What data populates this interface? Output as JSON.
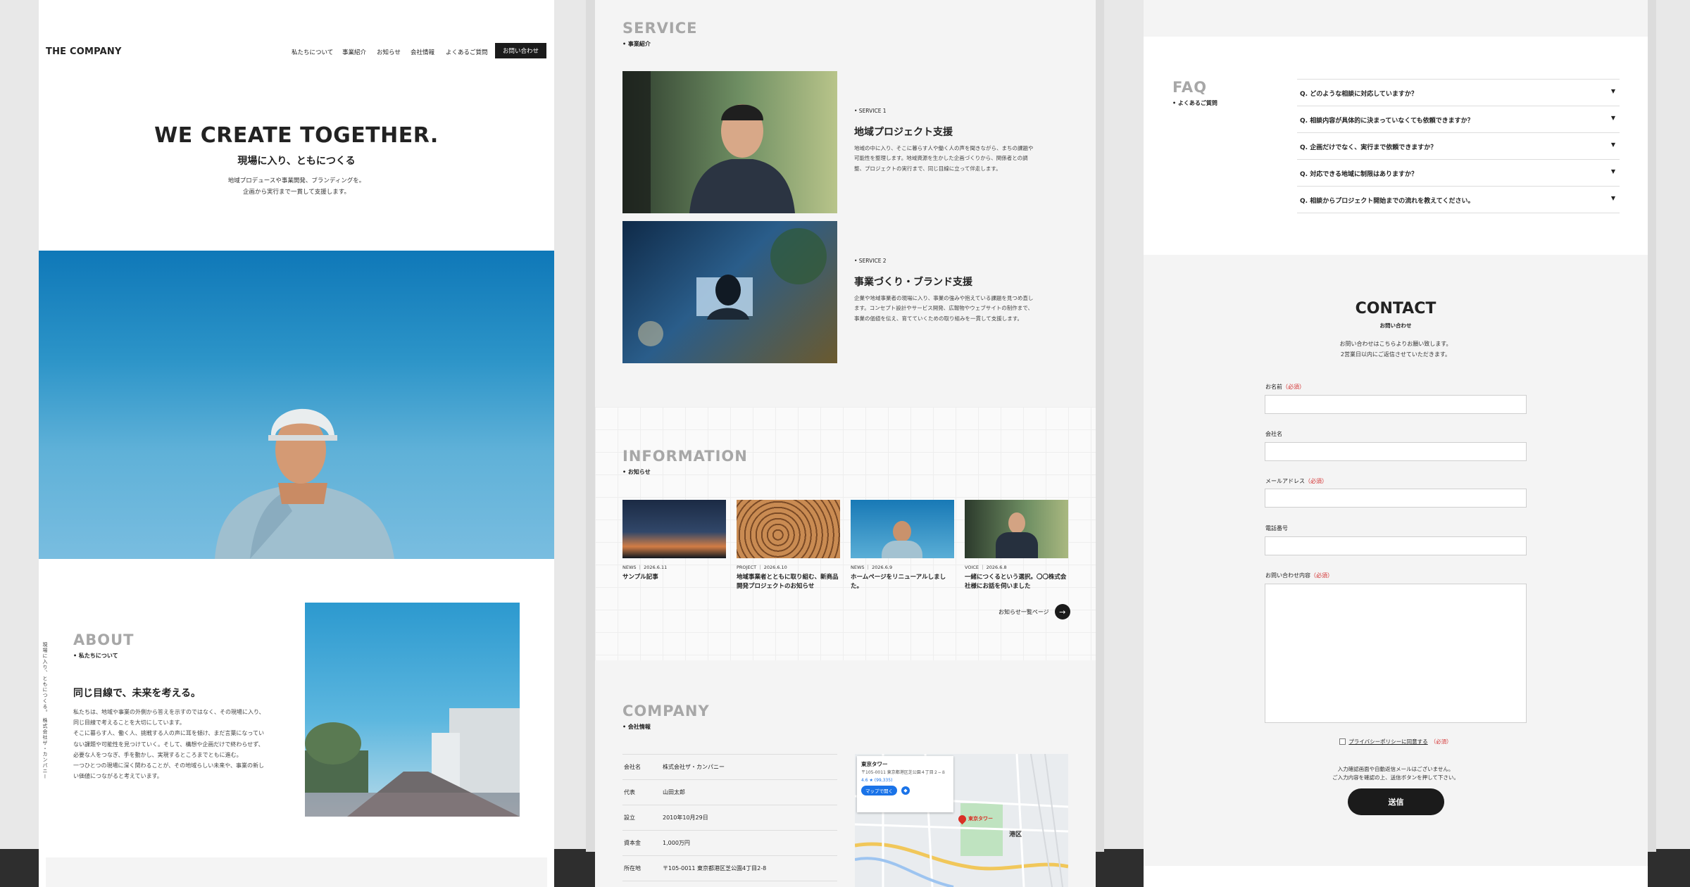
{
  "colors": {
    "accent": "#1b1b1b",
    "required": "#d32f2f",
    "section_title": "#a7a7a7"
  },
  "header": {
    "logo": "THE COMPANY",
    "nav": [
      "私たちについて",
      "事業紹介",
      "お知らせ",
      "会社情報",
      "よくあるご質問"
    ],
    "cta": "お問い合わせ"
  },
  "hero": {
    "title": "WE CREATE TOGETHER.",
    "subtitle": "現場に入り、ともにつくる",
    "lead1": "地域プロデュースや事業開発、ブランディングを。",
    "lead2": "企画から実行まで一貫して支援します。"
  },
  "about": {
    "title": "ABOUT",
    "sub": "• 私たちについて",
    "vertical": "現場に入り、ともにつくる。 株式会社ザ・カンパニー",
    "heading": "同じ目線で、未来を考える。",
    "body": [
      "私たちは、地域や事業の外側から答えを示すのではなく、その現場に入り、",
      "同じ目線で考えることを大切にしています。",
      "そこに暮らす人、働く人、挑戦する人の声に耳を傾け、まだ言葉になってい",
      "ない課題や可能性を見つけていく。そして、構想や企画だけで終わらせず、",
      "必要な人をつなぎ、手を動かし、実現するところまでともに進む。",
      "一つひとつの現場に深く関わることが、その地域らしい未来や、事業の新し",
      "い価値につながると考えています。"
    ]
  },
  "service": {
    "title": "SERVICE",
    "sub": "• 事業紹介",
    "items": [
      {
        "label": "• SERVICE 1",
        "heading": "地域プロジェクト支援",
        "body": [
          "地域の中に入り、そこに暮らす人や働く人の声を聞きながら、まちの課題や",
          "可能性を整理します。地域資源を生かした企画づくりから、関係者との調",
          "整、プロジェクトの実行まで、同じ目線に立って伴走します。"
        ]
      },
      {
        "label": "• SERVICE 2",
        "heading": "事業づくり・ブランド支援",
        "body": [
          "企業や地域事業者の現場に入り、事業の強みや抱えている課題を見つめ直し",
          "ます。コンセプト設計やサービス開発、広報物やウェブサイトの制作まで、",
          "事業の価値を伝え、育てていくための取り組みを一貫して支援します。"
        ]
      }
    ]
  },
  "information": {
    "title": "INFORMATION",
    "sub": "• お知らせ",
    "items": [
      {
        "meta": "NEWS ｜ 2026.6.11",
        "title": "サンプル記事"
      },
      {
        "meta": "PROJECT ｜ 2026.6.10",
        "title": "地域事業者とともに取り組む、新商品開発プロジェクトのお知らせ"
      },
      {
        "meta": "NEWS ｜ 2026.6.9",
        "title": "ホームページをリニューアルしました。"
      },
      {
        "meta": "VOICE ｜ 2026.6.8",
        "title": "一緒につくるという選択。〇〇株式会社様にお話を伺いました"
      }
    ],
    "more": "お知らせ一覧ページ"
  },
  "company": {
    "title": "COMPANY",
    "sub": "• 会社情報",
    "rows": [
      {
        "k": "会社名",
        "v": "株式会社ザ・カンパニー"
      },
      {
        "k": "代表",
        "v": "山田太郎"
      },
      {
        "k": "設立",
        "v": "2010年10月29日"
      },
      {
        "k": "資本金",
        "v": "1,000万円"
      },
      {
        "k": "所在地",
        "v": "〒105-0011 東京都港区芝公園4丁目2-8"
      }
    ],
    "map": {
      "place": "東京タワー",
      "address": "〒105-0011 東京都港区芝公園４丁目２−８",
      "rating": "4.6 ★ (99,335)",
      "open_button": "マップで開く",
      "marker": "東京タワー",
      "ward": "港区"
    }
  },
  "faq": {
    "title": "FAQ",
    "sub": "• よくあるご質問",
    "items": [
      "Q. どのような相談に対応していますか？",
      "Q. 相談内容が具体的に決まっていなくても依頼できますか？",
      "Q. 企画だけでなく、実行まで依頼できますか？",
      "Q. 対応できる地域に制限はありますか？",
      "Q. 相談からプロジェクト開始までの流れを教えてください。"
    ]
  },
  "contact": {
    "title": "CONTACT",
    "sub": "お問い合わせ",
    "lead1": "お問い合わせはこちらよりお願い致します。",
    "lead2": "2営業日以内にご返信させていただきます。",
    "required": "（必須）",
    "fields": {
      "name": "お名前",
      "company": "会社名",
      "email": "メールアドレス",
      "tel": "電話番号",
      "message": "お問い合わせ内容"
    },
    "privacy": "プライバシーポリシーに同意する",
    "note1": "入力確認画面や自動返信メールはございません。",
    "note2": "ご入力内容を確認の上、送信ボタンを押して下さい。",
    "submit": "送信"
  }
}
